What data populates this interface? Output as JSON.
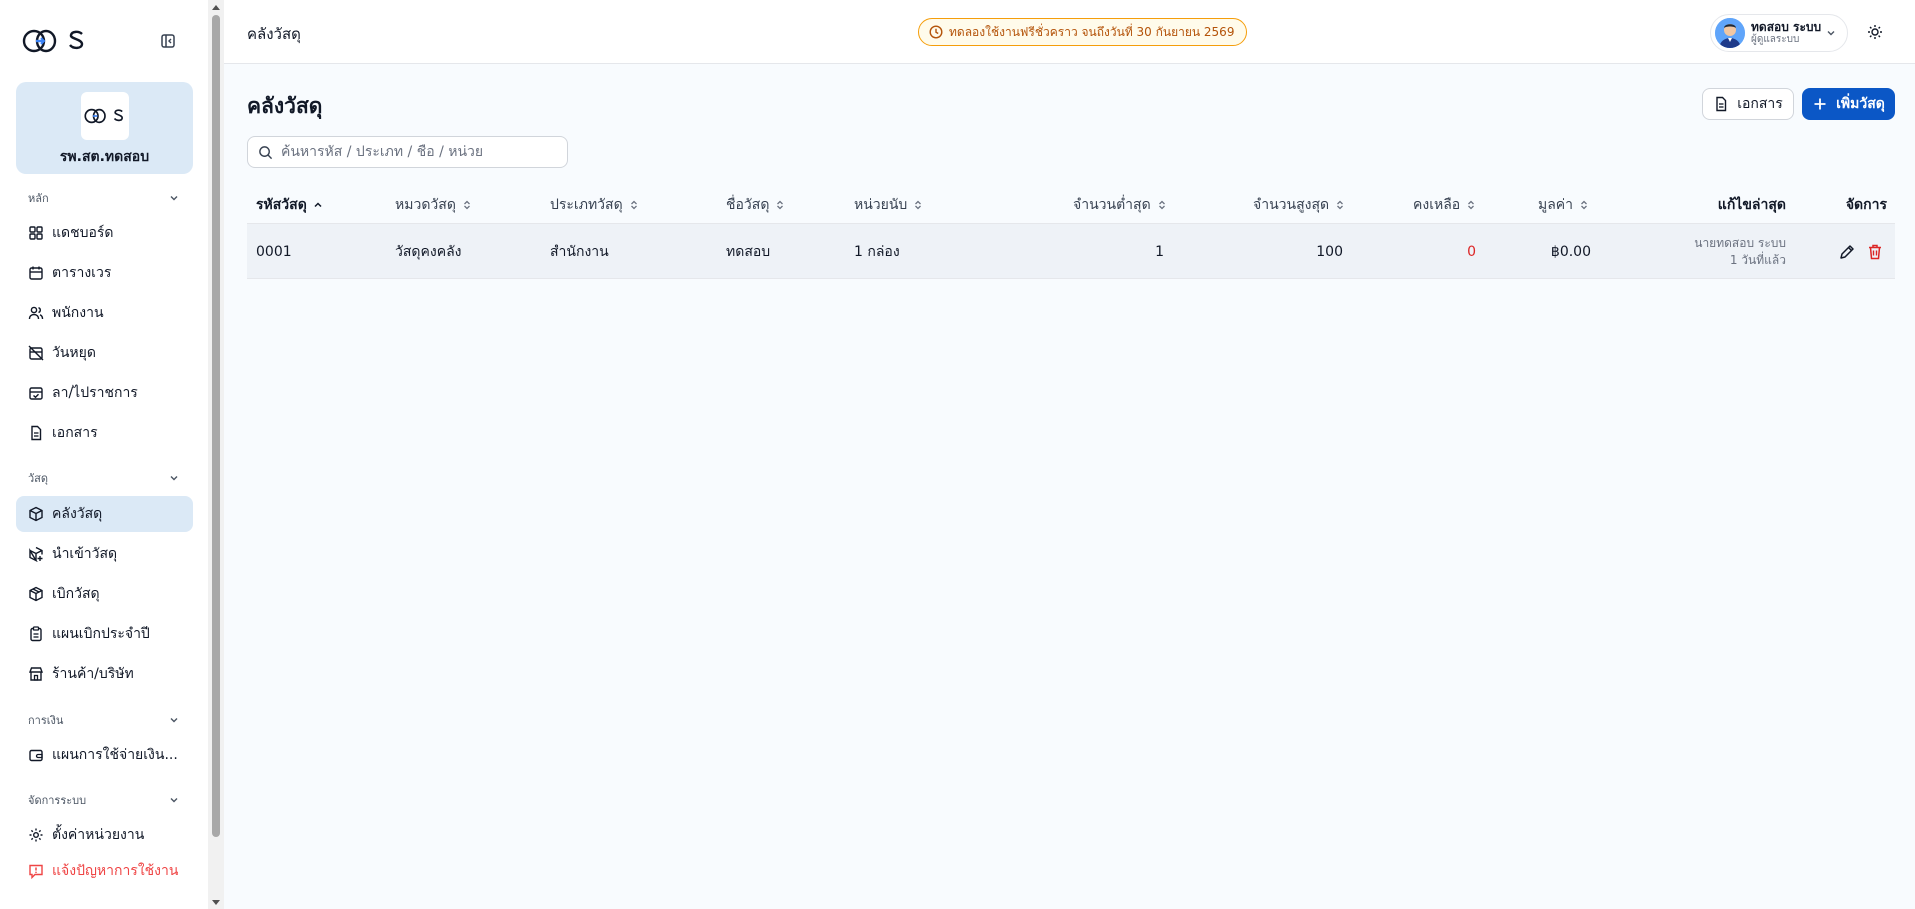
{
  "brand": {
    "logo_text": "ODS"
  },
  "org": {
    "name": "รพ.สต.ทดสอบ"
  },
  "sidebar": {
    "sections": [
      {
        "title": "หลัก",
        "items": [
          {
            "label": "แดชบอร์ด",
            "icon": "dashboard-icon"
          },
          {
            "label": "ตารางเวร",
            "icon": "calendar-icon"
          },
          {
            "label": "พนักงาน",
            "icon": "users-icon"
          },
          {
            "label": "วันหยุด",
            "icon": "calendar-off-icon"
          },
          {
            "label": "ลา/ไปราชการ",
            "icon": "calendar-check-icon"
          },
          {
            "label": "เอกสาร",
            "icon": "document-icon"
          }
        ]
      },
      {
        "title": "วัสดุ",
        "items": [
          {
            "label": "คลังวัสดุ",
            "icon": "package-icon",
            "active": true
          },
          {
            "label": "นำเข้าวัสดุ",
            "icon": "package-plus-icon"
          },
          {
            "label": "เบิกวัสดุ",
            "icon": "package-out-icon"
          },
          {
            "label": "แผนเบิกประจำปี",
            "icon": "clipboard-icon"
          },
          {
            "label": "ร้านค้า/บริษัท",
            "icon": "store-icon"
          }
        ]
      },
      {
        "title": "การเงิน",
        "items": [
          {
            "label": "แผนการใช้จ่ายเงิน...",
            "icon": "wallet-icon"
          }
        ]
      },
      {
        "title": "จัดการระบบ",
        "items": [
          {
            "label": "ตั้งค่าหน่วยงาน",
            "icon": "settings-icon"
          },
          {
            "label": "แจ้งปัญหาการใช้งาน",
            "icon": "report-issue-icon",
            "danger": true
          }
        ]
      }
    ]
  },
  "topbar": {
    "title": "คลังวัสดุ",
    "trial_notice": "ทดลองใช้งานฟรีชั่วคราว จนถึงวันที่ 30 กันยายน 2569",
    "user_name": "ทดสอบ ระบบ",
    "user_role": "ผู้ดูแลระบบ"
  },
  "main": {
    "title": "คลังวัสดุ",
    "doc_button": "เอกสาร",
    "add_button": "เพิ่มวัสดุ",
    "search_placeholder": "ค้นหารหัส / ประเภท / ชื่อ / หน่วย",
    "search_value": ""
  },
  "table": {
    "columns": [
      "รหัสวัสดุ",
      "หมวดวัสดุ",
      "ประเภทวัสดุ",
      "ชื่อวัสดุ",
      "หน่วยนับ",
      "จำนวนต่ำสุด",
      "จำนวนสูงสุด",
      "คงเหลือ",
      "มูลค่า",
      "แก้ไขล่าสุด",
      "จัดการ"
    ],
    "rows": [
      {
        "code": "0001",
        "category": "วัสดุคงคลัง",
        "type": "สำนักงาน",
        "name": "ทดสอบ",
        "unit": "1 กล่อง",
        "min": "1",
        "max": "100",
        "remaining": "0",
        "value": "฿0.00",
        "edited_by": "นายทดสอบ ระบบ",
        "edited_when": "1 วันที่แล้ว"
      }
    ]
  },
  "colors": {
    "primary": "#0b57c6",
    "active_bg": "#dbe9f6",
    "danger": "#ef4444",
    "warning": "#f59e0b"
  }
}
